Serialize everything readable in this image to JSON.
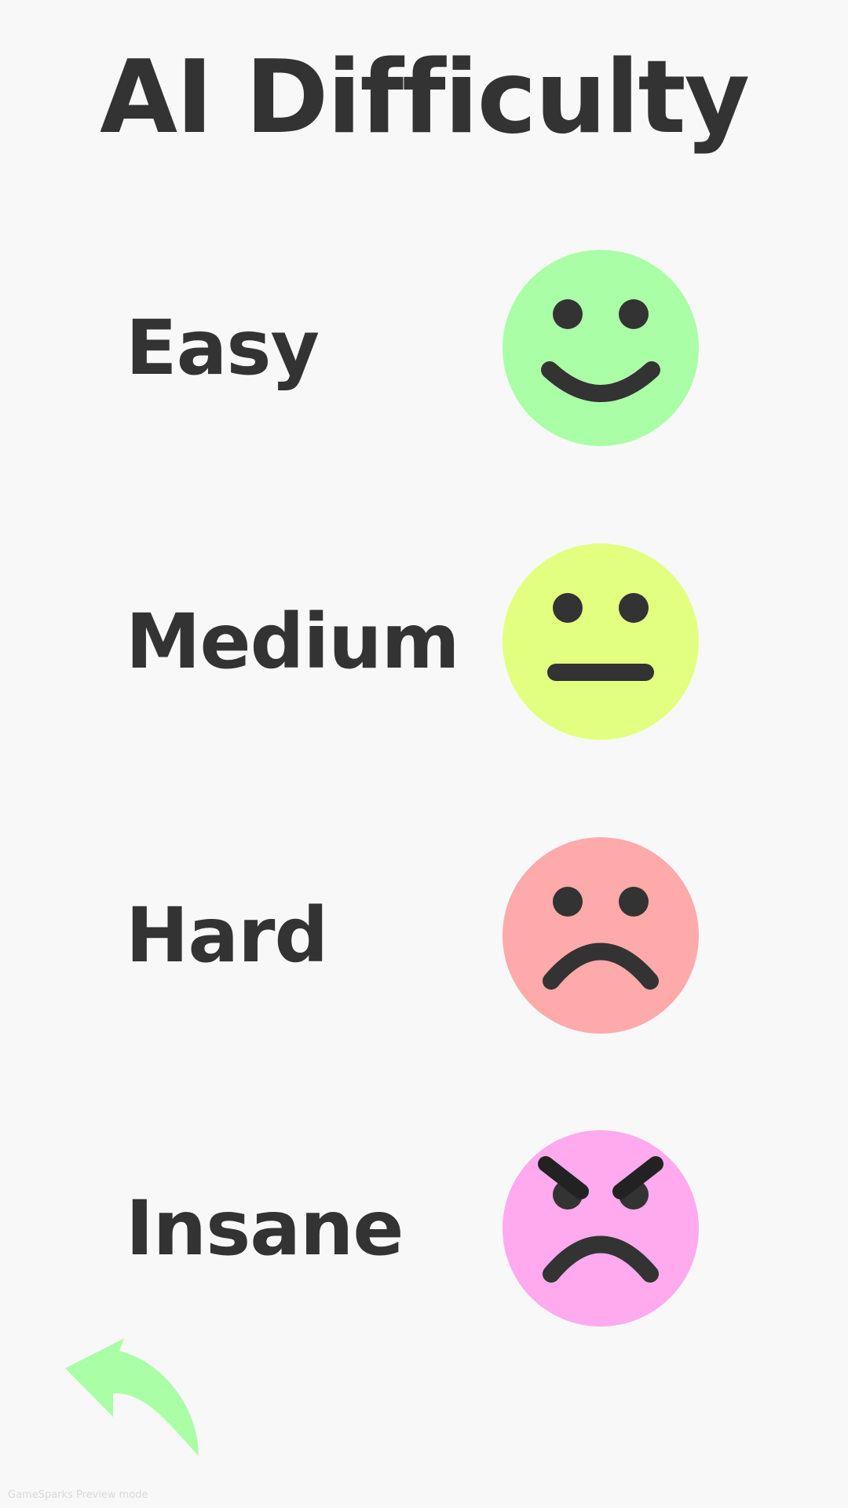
{
  "title": "AI Difficulty",
  "difficulties": [
    {
      "label": "Easy",
      "face_icon": "happy-face-icon",
      "color": "#aaffa6"
    },
    {
      "label": "Medium",
      "face_icon": "neutral-face-icon",
      "color": "#e3ff80"
    },
    {
      "label": "Hard",
      "face_icon": "sad-face-icon",
      "color": "#ffaaaa"
    },
    {
      "label": "Insane",
      "face_icon": "angry-face-icon",
      "color": "#ffaaee"
    }
  ],
  "back_button": {
    "icon": "back-arrow-icon",
    "color": "#aaffa6"
  },
  "footer": {
    "text": "GameSparks Preview mode"
  },
  "colors": {
    "background": "#f8f8f9",
    "text": "#333333"
  }
}
